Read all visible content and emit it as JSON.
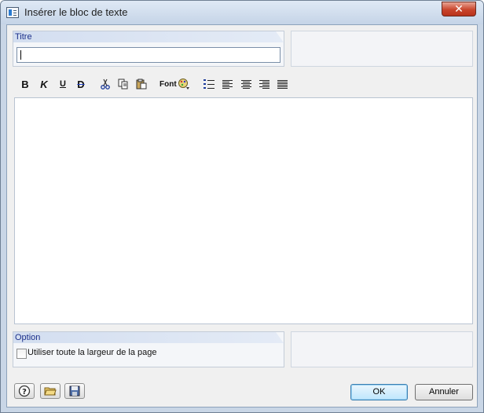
{
  "window": {
    "title": "Insérer le bloc de texte",
    "close_label": "✕"
  },
  "title_group": {
    "label": "Titre",
    "input_value": ""
  },
  "toolbar": {
    "bold": "B",
    "italic": "K",
    "underline": "U",
    "strike": "D",
    "font": "Font",
    "icons": [
      "cut-icon",
      "copy-icon",
      "paste-icon",
      "color-icon",
      "bullet-list-icon",
      "align-left-icon",
      "align-center-icon",
      "align-right-icon",
      "justify-icon"
    ]
  },
  "option_group": {
    "label": "Option",
    "checkbox_label": "Utiliser toute la largeur de la page",
    "checked": false
  },
  "buttons": {
    "ok": "OK",
    "cancel": "Annuler"
  },
  "colors": {
    "header_text": "#1b2f8a",
    "accent": "#3c7fb1",
    "close": "#c9452c"
  }
}
